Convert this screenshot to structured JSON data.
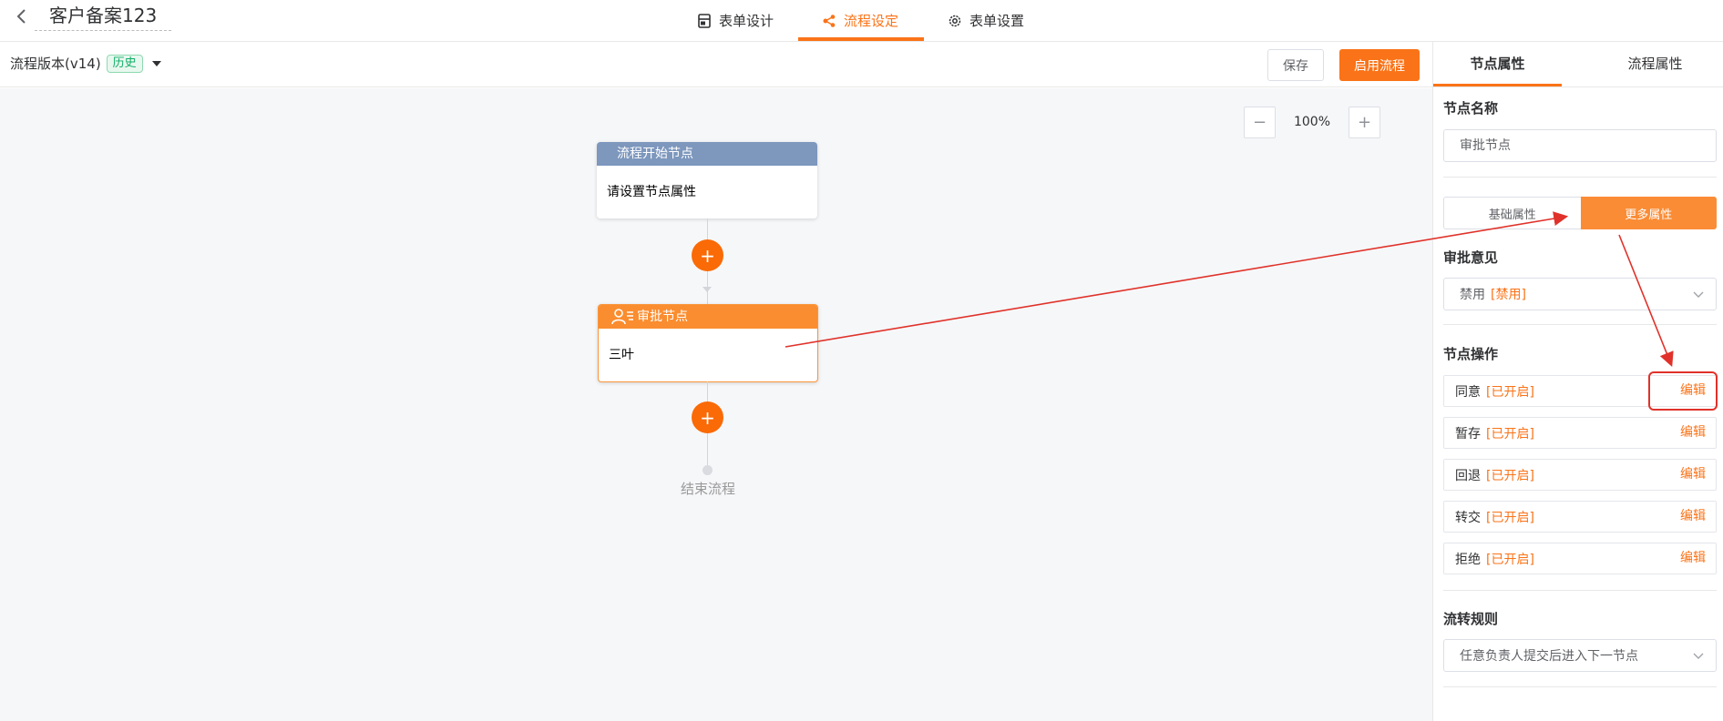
{
  "header": {
    "form_title": "客户备案123",
    "tabs": [
      {
        "label": "表单设计",
        "icon": "form-icon",
        "active": false
      },
      {
        "label": "流程设定",
        "icon": "flow-icon",
        "active": true
      },
      {
        "label": "表单设置",
        "icon": "gear-icon",
        "active": false
      }
    ]
  },
  "toolbar": {
    "version_label": "流程版本(v14)",
    "history_badge": "历史",
    "save_label": "保存",
    "enable_label": "启用流程"
  },
  "canvas": {
    "zoom_minus": "−",
    "zoom_level": "100%",
    "zoom_plus": "+",
    "start_node": {
      "title": "流程开始节点",
      "body": "请设置节点属性"
    },
    "approve_node": {
      "title": "审批节点",
      "body": "三叶"
    },
    "add_symbol": "+",
    "end_label": "结束流程"
  },
  "panel": {
    "tabs": [
      {
        "label": "节点属性",
        "active": true
      },
      {
        "label": "流程属性",
        "active": false
      }
    ],
    "node_name_label": "节点名称",
    "node_name_value": "审批节点",
    "segment": {
      "basic": "基础属性",
      "more": "更多属性",
      "active": "more"
    },
    "opinion_label": "审批意见",
    "opinion_value": "禁用",
    "opinion_tag": "[禁用]",
    "operations_label": "节点操作",
    "operations": [
      {
        "name": "同意",
        "status": "[已开启]",
        "edit": "编辑"
      },
      {
        "name": "暂存",
        "status": "[已开启]",
        "edit": "编辑"
      },
      {
        "name": "回退",
        "status": "[已开启]",
        "edit": "编辑"
      },
      {
        "name": "转交",
        "status": "[已开启]",
        "edit": "编辑"
      },
      {
        "name": "拒绝",
        "status": "[已开启]",
        "edit": "编辑"
      }
    ],
    "rule_label": "流转规则",
    "rule_value": "任意负责人提交后进入下一节点"
  },
  "colors": {
    "accent": "#fa7318",
    "start_header": "#7d97bd",
    "approve_header": "#fa8d2f",
    "annotation": "#e0322a"
  }
}
